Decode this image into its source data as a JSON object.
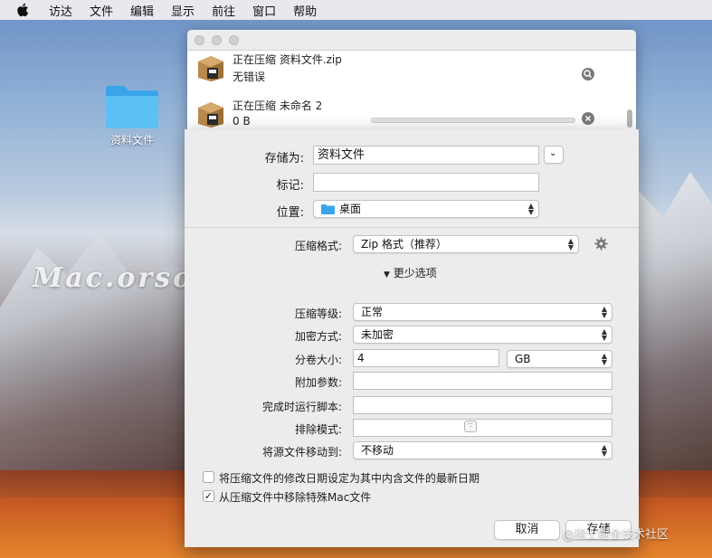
{
  "menubar": {
    "apple_icon": "apple-icon",
    "items": [
      "访达",
      "文件",
      "编辑",
      "显示",
      "前往",
      "窗口",
      "帮助"
    ]
  },
  "desktop": {
    "folder_label": "资料文件",
    "watermark": "Mac.orsoon.com",
    "credit": "@稀土掘金技术社区"
  },
  "progress_window": {
    "jobs": [
      {
        "name": "正在压缩 资料文件.zip",
        "status": "无错误",
        "action_icon": "magnifier-icon"
      },
      {
        "name": "正在压缩 未命名 2",
        "status": "0 B",
        "action_icon": "close-icon",
        "progress": 0
      }
    ]
  },
  "save_sheet": {
    "save_as_label": "存储为:",
    "save_as_value": "资料文件",
    "tags_label": "标记:",
    "tags_value": "",
    "location_label": "位置:",
    "location_value": "桌面",
    "format_label": "压缩格式:",
    "format_value": "Zip 格式（推荐）",
    "more_options": "更少选项",
    "level_label": "压缩等级:",
    "level_value": "正常",
    "encrypt_label": "加密方式:",
    "encrypt_value": "未加密",
    "split_label": "分卷大小:",
    "split_value": "4",
    "split_unit": "GB",
    "params_label": "附加参数:",
    "params_value": "",
    "script_label": "完成时运行脚本:",
    "script_value": "",
    "exclude_label": "排除模式:",
    "exclude_value": "",
    "move_label": "将源文件移动到:",
    "move_value": "不移动",
    "option1": {
      "label": "将压缩文件的修改日期设定为其中内含文件的最新日期",
      "checked": false
    },
    "option2": {
      "label": "从压缩文件中移除特殊Mac文件",
      "checked": true
    },
    "cancel": "取消",
    "save": "存储"
  }
}
